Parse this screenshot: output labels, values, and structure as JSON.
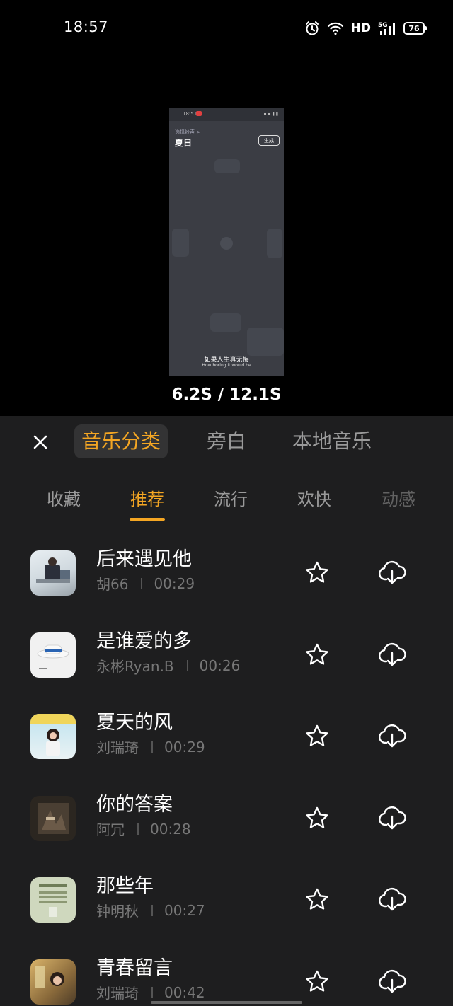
{
  "status_bar": {
    "time": "18:57",
    "hd": "HD",
    "network": "5G",
    "battery": "76"
  },
  "preview": {
    "time": "18:51",
    "sub": "选择铃声 >",
    "title": "夏日",
    "button": "生成",
    "lyric_line1": "如果人生真无悔",
    "lyric_line2": "How boring it would be"
  },
  "timer": "6.2S / 12.1S",
  "category_tabs": [
    "音乐分类",
    "旁白",
    "本地音乐"
  ],
  "sub_tabs": [
    "收藏",
    "推荐",
    "流行",
    "欢快",
    "动感"
  ],
  "songs": [
    {
      "title": "后来遇见他",
      "artist": "胡66",
      "duration": "00:29"
    },
    {
      "title": "是谁爱的多",
      "artist": "永彬Ryan.B",
      "duration": "00:26"
    },
    {
      "title": "夏天的风",
      "artist": "刘瑞琦",
      "duration": "00:29"
    },
    {
      "title": "你的答案",
      "artist": "阿冗",
      "duration": "00:28"
    },
    {
      "title": "那些年",
      "artist": "钟明秋",
      "duration": "00:27"
    },
    {
      "title": "青春留言",
      "artist": "刘瑞琦",
      "duration": "00:42"
    }
  ],
  "colors": {
    "accent": "#f4a623",
    "sheet_bg": "#1e1e1f"
  }
}
